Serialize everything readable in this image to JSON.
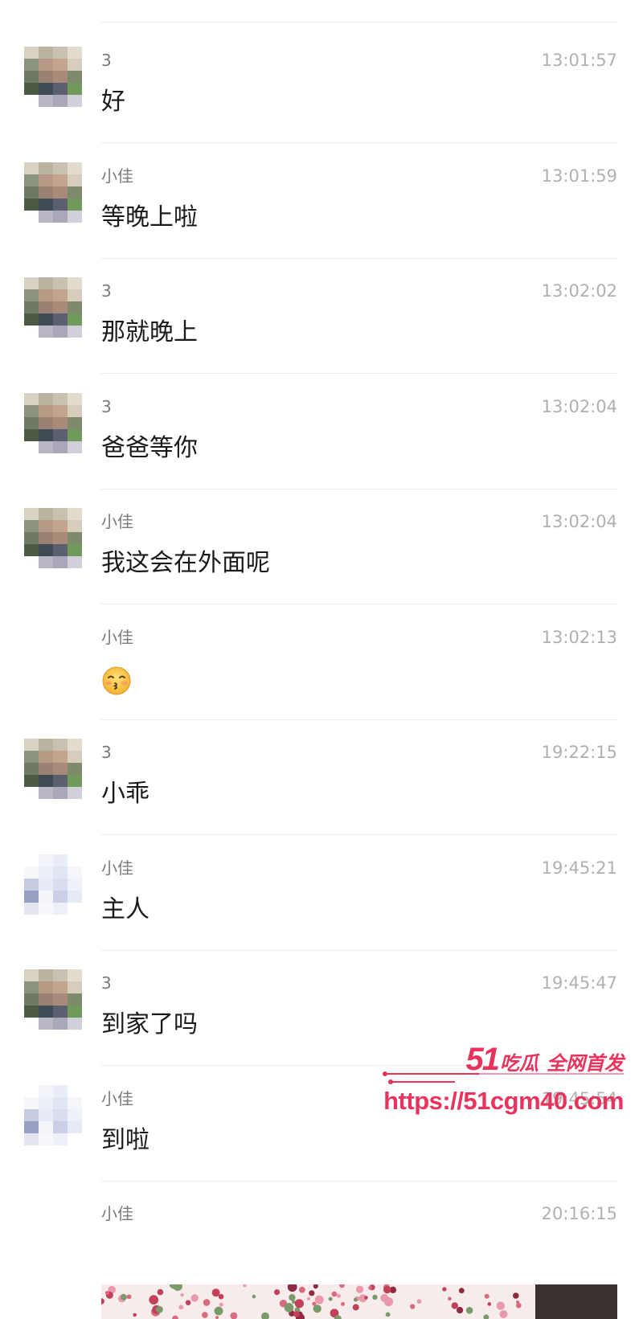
{
  "messages": [
    {
      "sender": "3",
      "time": "13:01:57",
      "text": "好",
      "avatar": "dad"
    },
    {
      "sender": "小佳",
      "time": "13:01:59",
      "text": "等晚上啦",
      "avatar": "dad"
    },
    {
      "sender": "3",
      "time": "13:02:02",
      "text": "那就晚上",
      "avatar": "dad"
    },
    {
      "sender": "3",
      "time": "13:02:04",
      "text": "爸爸等你",
      "avatar": "dad"
    },
    {
      "sender": "小佳",
      "time": "13:02:04",
      "text": "我这会在外面呢",
      "avatar": "dad"
    },
    {
      "sender": "小佳",
      "time": "13:02:13",
      "text": "",
      "emoji": "kissing-face-emoji",
      "avatar": "none"
    },
    {
      "sender": "3",
      "time": "19:22:15",
      "text": "小乖",
      "avatar": "dad"
    },
    {
      "sender": "小佳",
      "time": "19:45:21",
      "text": "主人",
      "avatar": "girl"
    },
    {
      "sender": "3",
      "time": "19:45:47",
      "text": "到家了吗",
      "avatar": "dad"
    },
    {
      "sender": "小佳",
      "time": "19:45:54",
      "text": "到啦",
      "avatar": "girl"
    },
    {
      "sender": "小佳",
      "time": "20:16:15",
      "text": "",
      "image": "floral-photo",
      "avatar": "none"
    }
  ],
  "watermark": {
    "brand_number": "51",
    "brand_name": "吃瓜",
    "brand_tag": "全网首发",
    "url": "https://51cgm40.com",
    "color": "#e8335c"
  },
  "colors": {
    "sender": "#7a7a7a",
    "time": "#b0b0b0",
    "text": "#1a1a1a",
    "divider": "#ebebeb"
  }
}
